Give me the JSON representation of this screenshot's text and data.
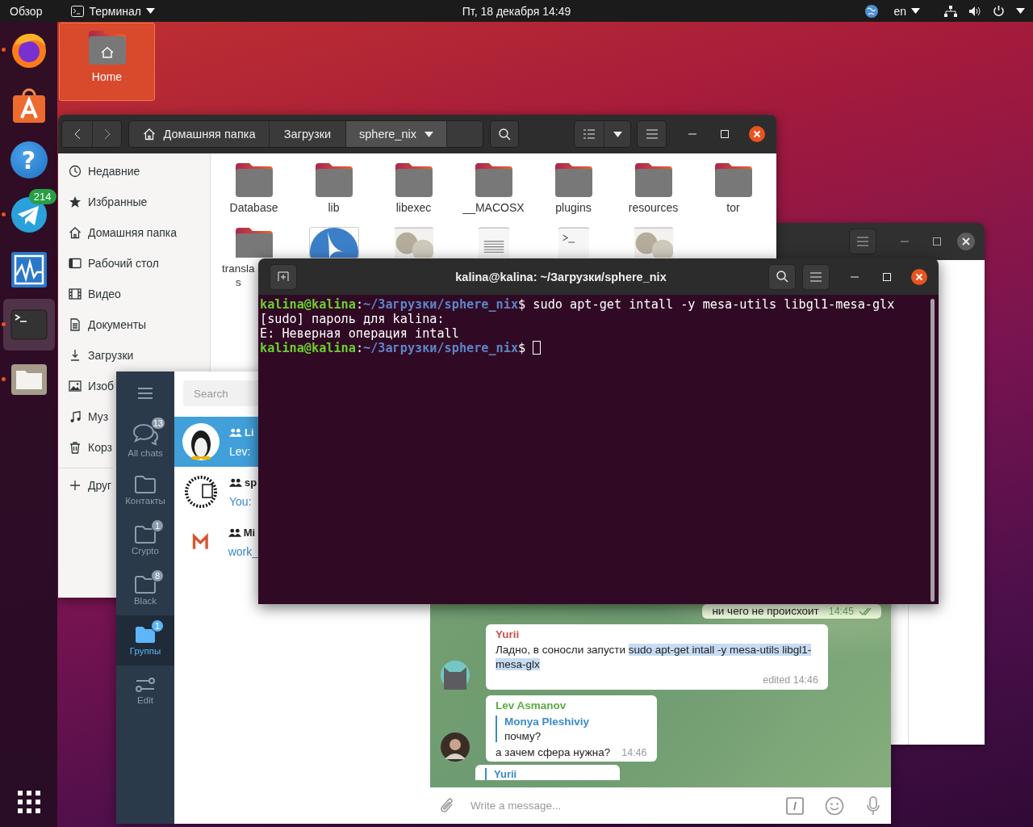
{
  "top_bar": {
    "activities": "Обзор",
    "app_menu": "Терминал",
    "clock": "Пт, 18 декабря  14:49",
    "keyboard_layout": "en"
  },
  "dock": {
    "apps": [
      {
        "kind": "browser",
        "running": true,
        "selected": false
      },
      {
        "kind": "store",
        "running": false,
        "selected": false
      },
      {
        "kind": "help",
        "glyph": "?",
        "running": false,
        "selected": false
      },
      {
        "kind": "messenger",
        "badge": "214",
        "running": true,
        "selected": false
      },
      {
        "kind": "monitor",
        "running": false,
        "selected": false
      },
      {
        "kind": "terminal",
        "running": true,
        "selected": true
      },
      {
        "kind": "files",
        "running": true,
        "selected": false
      }
    ]
  },
  "desktop_icons": [
    {
      "label": "Home",
      "selected": true
    }
  ],
  "files_window": {
    "path": [
      {
        "label": "Домашняя папка",
        "kind": "home",
        "selected": false
      },
      {
        "label": "Загрузки",
        "kind": "folder",
        "selected": false
      },
      {
        "label": "sphere_nix",
        "kind": "menu",
        "selected": true
      }
    ],
    "sidebar": [
      {
        "label": "Недавние",
        "kind": "recent"
      },
      {
        "label": "Избранные",
        "kind": "star"
      },
      {
        "label": "Домашняя папка",
        "kind": "home"
      },
      {
        "label": "Рабочий стол",
        "kind": "desktop"
      },
      {
        "label": "Видео",
        "kind": "video"
      },
      {
        "label": "Документы",
        "kind": "document"
      },
      {
        "label": "Загрузки",
        "kind": "download"
      },
      {
        "label": "Изоб",
        "kind": "image"
      },
      {
        "label": "Муз",
        "kind": "music"
      },
      {
        "label": "Корз",
        "kind": "trash"
      },
      {
        "label": "Друг",
        "kind": "other"
      }
    ],
    "items": [
      {
        "name": "Database",
        "kind": "folder",
        "selected": false
      },
      {
        "name": "lib",
        "kind": "folder",
        "selected": false
      },
      {
        "name": "libexec",
        "kind": "folder",
        "selected": false
      },
      {
        "name": "__MACOSX",
        "kind": "folder",
        "selected": false
      },
      {
        "name": "plugins",
        "kind": "folder",
        "selected": false
      },
      {
        "name": "resources",
        "kind": "folder",
        "selected": false
      },
      {
        "name": "tor",
        "kind": "folder",
        "selected": false
      },
      {
        "name_lines": [
          "transla",
          "s"
        ],
        "kind": "folder",
        "selected": false
      },
      {
        "kind": "app",
        "selected": true
      },
      {
        "kind": "settings-file",
        "selected": false
      },
      {
        "kind": "text-file",
        "selected": false
      },
      {
        "kind": "script-file",
        "selected": false
      },
      {
        "kind": "settings-file",
        "selected": false
      }
    ]
  },
  "telegram": {
    "search_placeholder": "Search",
    "folders": [
      {
        "label": "All chats",
        "kind": "chats",
        "badge": "13",
        "selected": false
      },
      {
        "label": "Контакты",
        "kind": "folder",
        "selected": false
      },
      {
        "label": "Crypto",
        "kind": "folder",
        "badge": "1",
        "selected": false
      },
      {
        "label": "Black",
        "kind": "folder",
        "badge": "8",
        "selected": false
      },
      {
        "label": "Группы",
        "kind": "folder",
        "badge": "1",
        "selected": true
      },
      {
        "label": "Edit",
        "kind": "edit",
        "selected": false
      }
    ],
    "chats": [
      {
        "title": "Li",
        "preview": "Lev:",
        "kind": "bird",
        "selected": true
      },
      {
        "title": "sp",
        "preview": "You:",
        "kind": "moon",
        "selected": false
      },
      {
        "title": "Mi",
        "preview": "work_",
        "kind": "m-logo",
        "selected": false
      }
    ],
    "messages": [
      {
        "kind": "outgoing",
        "text": "ни чего не происхоит",
        "time": "14:45",
        "read": true
      },
      {
        "kind": "incoming",
        "author": "Yurii",
        "color": "#c9514a",
        "text": "Ладно, в соносли запусти ",
        "selected_text": "sudo apt-get intall -y mesa-utils libgl1-mesa-glx",
        "time": "edited 14:46",
        "avatar": {
          "kind": "cat"
        }
      },
      {
        "kind": "incoming",
        "author": "Lev Asmanov",
        "color": "#5eaa43",
        "reply": {
          "author": "Monya Pleshiviy",
          "text": "почму?"
        },
        "text": "а зачем сфера нужна?",
        "time": "14:46",
        "avatar": {
          "kind": "person"
        }
      },
      {
        "kind": "partial",
        "reply": {
          "author": "Yurii"
        }
      }
    ],
    "composer": {
      "placeholder": "Write a message..."
    }
  },
  "terminal": {
    "title": "kalina@kalina: ~/Загрузки/sphere_nix",
    "lines": [
      {
        "cursor": false,
        "segments": [
          {
            "kind": "user",
            "text": "kalina@kalina"
          },
          {
            "kind": "plain",
            "text": ":"
          },
          {
            "kind": "path",
            "text": "~/Загрузки/sphere_nix"
          },
          {
            "kind": "plain",
            "text": "$ sudo apt-get intall -y mesa-utils libgl1-mesa-glx"
          }
        ]
      },
      {
        "cursor": false,
        "segments": [
          {
            "kind": "plain",
            "text": "[sudo] пароль для kalina:"
          }
        ]
      },
      {
        "cursor": false,
        "segments": [
          {
            "kind": "plain",
            "text": "E: Неверная операция intall"
          }
        ]
      },
      {
        "cursor": true,
        "segments": [
          {
            "kind": "user",
            "text": "kalina@kalina"
          },
          {
            "kind": "plain",
            "text": ":"
          },
          {
            "kind": "path",
            "text": "~/Загрузки/sphere_nix"
          },
          {
            "kind": "plain",
            "text": "$ "
          }
        ]
      }
    ]
  }
}
